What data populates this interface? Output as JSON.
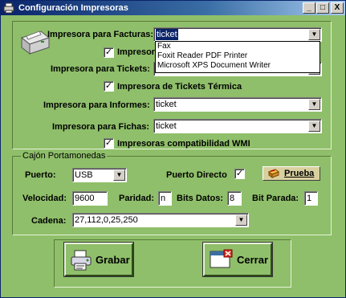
{
  "window": {
    "title": "Configuración Impresoras",
    "minimize": "_",
    "maximize": "□",
    "close": "X"
  },
  "printers": {
    "facturas_label": "Impresora para Facturas:",
    "facturas_value": "ticket",
    "fiscal_check_label": "Impresora",
    "tickets_label": "Impresora para Tickets:",
    "tickets_thermal_label": "Impresora de Tickets Térmica",
    "informes_label": "Impresora para Informes:",
    "informes_value": "ticket",
    "fichas_label": "Impresora para Fichas:",
    "fichas_value": "ticket",
    "wmi_label": "Impresoras compatibilidad WMI",
    "dropdown_options": [
      "Fax",
      "Foxit Reader PDF Printer",
      "Microsoft XPS Document Writer"
    ]
  },
  "cash_drawer": {
    "group_title": "Cajón Portamonedas",
    "port_label": "Puerto:",
    "port_value": "USB",
    "direct_port_label": "Puerto Directo",
    "test_button": "Prueba",
    "speed_label": "Velocidad:",
    "speed_value": "9600",
    "parity_label": "Paridad:",
    "parity_value": "n",
    "data_bits_label": "Bits Datos:",
    "data_bits_value": "8",
    "stop_bits_label": "Bit Parada:",
    "stop_bits_value": "1",
    "chain_label": "Cadena:",
    "chain_value": "27,112,0,25,250"
  },
  "actions": {
    "save": "Grabar",
    "close": "Cerrar"
  },
  "checkmark": "✓"
}
